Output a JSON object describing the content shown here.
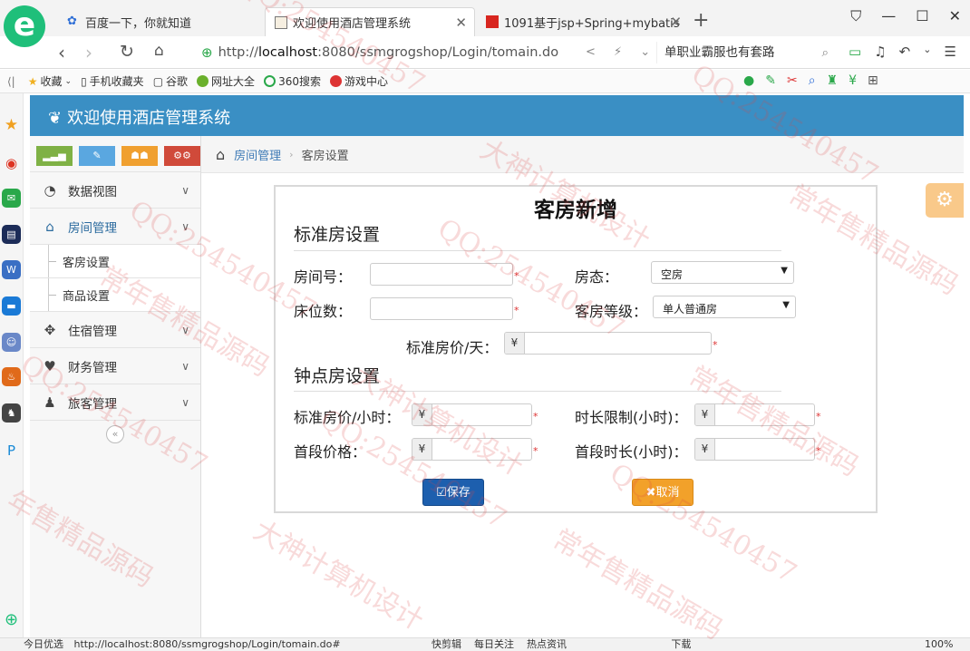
{
  "browser": {
    "tabs": [
      {
        "title": "百度一下，你就知道",
        "icon": "baidu-paw-icon"
      },
      {
        "title": "欢迎使用酒店管理系统",
        "icon": "page-icon"
      },
      {
        "title": "1091基于jsp+Spring+mybatis",
        "icon": "flag-icon"
      }
    ],
    "address": {
      "scheme": "http://",
      "host": "localhost",
      "rest": ":8080/ssmgrogshop/Login/tomain.do"
    },
    "search_text": "单职业霸服也有套路",
    "bookmarks": [
      "收藏",
      "手机收藏夹",
      "谷歌",
      "网址大全",
      "360搜索",
      "游戏中心"
    ],
    "status_left": "今日优选",
    "status_url": "http://localhost:8080/ssmgrogshop/Login/tomain.do#",
    "status_items": [
      "快剪辑",
      "每日关注",
      "热点资讯",
      "下载"
    ],
    "zoom": "100%"
  },
  "app": {
    "title": "欢迎使用酒店管理系统",
    "sidebar": {
      "items": [
        {
          "label": "数据视图",
          "icon": "dashboard-icon"
        },
        {
          "label": "房间管理",
          "icon": "home-icon"
        },
        {
          "label": "住宿管理",
          "icon": "move-icon"
        },
        {
          "label": "财务管理",
          "icon": "heart-icon"
        },
        {
          "label": "旅客管理",
          "icon": "user-icon"
        }
      ],
      "submenu": [
        "客房设置",
        "商品设置"
      ]
    },
    "breadcrumb": {
      "parent": "房间管理",
      "current": "客房设置"
    }
  },
  "form": {
    "title": "客房新增",
    "section1": "标准房设置",
    "section2": "钟点房设置",
    "room_no_label": "房间号：",
    "room_status_label": "房态：",
    "room_status_value": "空房",
    "beds_label": "床位数：",
    "room_level_label": "客房等级：",
    "room_level_value": "单人普通房",
    "std_price_label": "标准房价/天：",
    "hourly_price_label": "标准房价/小时：",
    "time_limit_label": "时长限制(小时)：",
    "first_price_label": "首段价格：",
    "first_duration_label": "首段时长(小时)：",
    "currency": "¥",
    "required": "*",
    "save_label": "保存",
    "cancel_label": "取消"
  },
  "watermarks": [
    "QQ:254540457",
    "大神计算机设计",
    "常年售精品源码",
    "年售精品源码"
  ]
}
